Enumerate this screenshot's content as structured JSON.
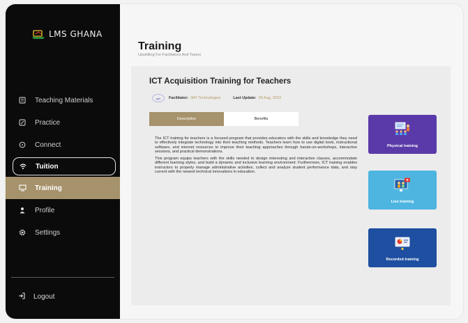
{
  "app": {
    "logo_text": "LMS GHANA"
  },
  "sidebar": {
    "items": [
      {
        "label": "Teaching Materials",
        "icon": "book-icon"
      },
      {
        "label": "Practice",
        "icon": "edit-icon"
      },
      {
        "label": "Connect",
        "icon": "chat-icon"
      },
      {
        "label": "Tuition",
        "icon": "wifi-icon"
      },
      {
        "label": "Training",
        "icon": "training-icon"
      },
      {
        "label": "Profile",
        "icon": "user-icon"
      },
      {
        "label": "Settings",
        "icon": "gear-icon"
      }
    ],
    "logout_label": "Logout"
  },
  "header": {
    "title": "Training",
    "subtitle": "Upskilling For Facilitators And Teams"
  },
  "course": {
    "title": "ICT Acquisition Training for Teachers",
    "facilitator_label": "Facilitator:",
    "facilitator_value": "IIAT Technologies",
    "facilitator_logo": "apn",
    "last_update_label": "Last Update:",
    "last_update_value": "29 Aug, 2023",
    "tabs": [
      {
        "label": "Description"
      },
      {
        "label": "Benefits"
      }
    ],
    "description": [
      "The ICT training for teachers is a focused program that provides educators with the skills and knowledge they need to effectively integrate technology into their teaching methods. Teachers learn how to use digital tools, instructional software, and internet resources to improve their teaching approaches through hands-on-workshops, interactive sessions, and practical demonstrations.",
      "This program equips teachers with the skills needed to design interesting and interactive classes, accommodate different learning styles, and build a dynamic and inclusive learning environment. Furthermore, ICT training enables instructors to properly manage administrative activities, collect and analyze student performance data, and stay current with the newest technical innovations in education."
    ]
  },
  "tiles": [
    {
      "label": "Physical training",
      "color": "#5a3aa8"
    },
    {
      "label": "Live training",
      "color": "#4eb5e0"
    },
    {
      "label": "Recorded training",
      "color": "#1e4fa0"
    }
  ],
  "colors": {
    "accent": "#a6926b",
    "sidebar_bg": "#0b0b0b"
  }
}
